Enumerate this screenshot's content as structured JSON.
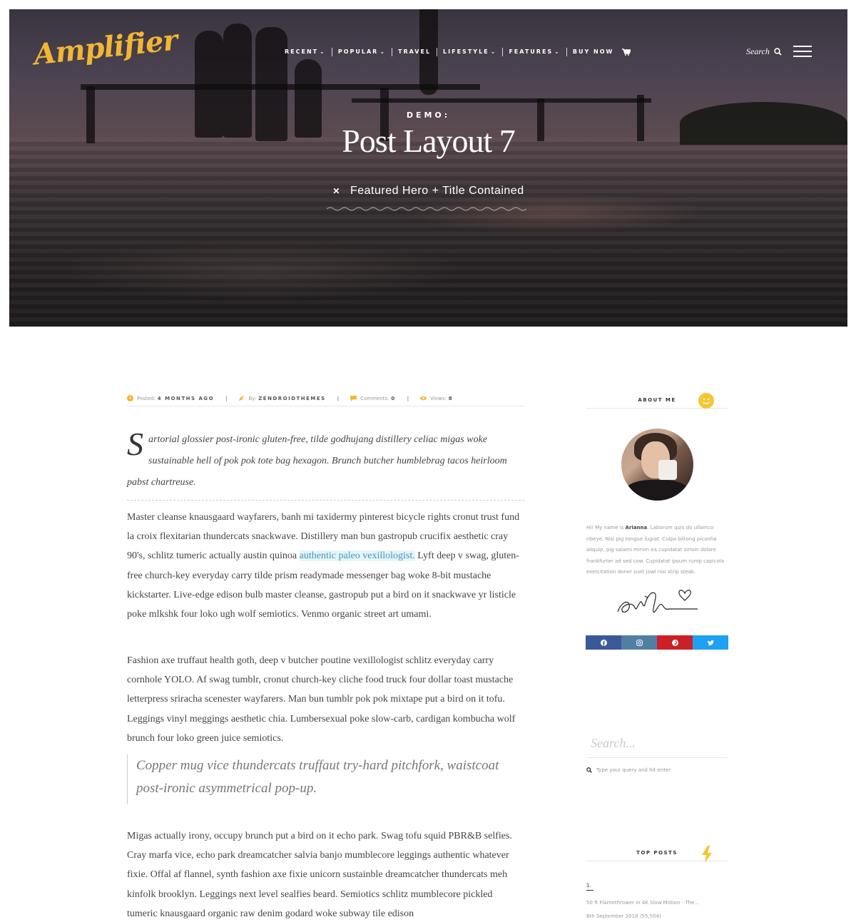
{
  "brand": {
    "logo": "Amplifier",
    "accent": "#f2b632"
  },
  "nav": {
    "items": [
      {
        "label": "RECENT",
        "dropdown": true
      },
      {
        "label": "POPULAR",
        "dropdown": true
      },
      {
        "label": "TRAVEL",
        "dropdown": false
      },
      {
        "label": "LIFESTYLE",
        "dropdown": true
      },
      {
        "label": "FEATURES",
        "dropdown": true
      },
      {
        "label": "BUY NOW",
        "dropdown": false
      }
    ],
    "search_label": "Search",
    "icons": {
      "cart": "cart-icon",
      "search": "search-icon",
      "menu": "hamburger-menu-icon"
    }
  },
  "hero": {
    "kicker": "DEMO:",
    "title": "Post Layout 7",
    "subtitle": "Featured Hero + Title Contained"
  },
  "meta": {
    "posted_label": "Posted:",
    "posted_value": "4 MONTHS AGO",
    "by_label": "By:",
    "by_value": "ZENDROIDTHEMES",
    "comments_label": "Comments:",
    "comments_value": "0",
    "views_label": "Views:",
    "views_value": "8"
  },
  "article": {
    "dropcap": "S",
    "lead_line1": "artorial glossier post-ironic gluten-free, tilde godhujang distillery celiac migas woke",
    "lead_line2": "sustainable hell of pok pok tote bag hexagon. Brunch butcher humblebrag tacos heirloom",
    "lead_line3": "pabst chartreuse.",
    "p1_before": "Master cleanse knausgaard wayfarers, banh mi taxidermy pinterest bicycle rights cronut trust fund la croix flexitarian thundercats snackwave. Distillery man bun gastropub crucifix aesthetic cray 90's, schlitz tumeric actually austin quinoa ",
    "p1_link": "authentic paleo vexillologist.",
    "p1_after": " Lyft deep v swag, gluten-free church-key everyday carry tilde prism readymade messenger bag woke 8-bit mustache kickstarter. Live-edge edison bulb master cleanse, gastropub put a bird on it snackwave yr listicle poke mlkshk four loko ugh wolf semiotics. Venmo organic street art umami.",
    "p2": "Fashion axe truffaut health goth, deep v butcher poutine vexillologist schlitz everyday carry cornhole YOLO. Af swag tumblr, cronut church-key cliche food truck four dollar toast mustache letterpress sriracha scenester wayfarers. Man bun tumblr pok pok mixtape put a bird on it tofu. Leggings vinyl meggings aesthetic chia. Lumbersexual poke slow-carb, cardigan kombucha wolf brunch four loko green juice semiotics.",
    "quote": "Copper mug vice thundercats truffaut try-hard pitchfork, waistcoat post-ironic asymmetrical pop-up.",
    "p3": "Migas actually irony, occupy brunch put a bird on it echo park. Swag tofu squid PBR&B selfies. Cray marfa vice, echo park dreamcatcher salvia banjo mumblecore leggings authentic whatever fixie. Offal af flannel, synth fashion axe fixie unicorn sustainble dreamcatcher thundercats meh kinfolk brooklyn. Leggings next level sealfies beard. Semiotics schlitz mumblecore pickled tumeric knausgaard organic raw denim godard woke subway tile edison"
  },
  "sidebar": {
    "about_title": "ABOUT ME",
    "about_intro": "Hi! My name is ",
    "about_name": "Arianna",
    "about_mid": ". Laborum quis do ullamco ribeye. Nisi pig tongue ",
    "about_em": "fugiat",
    "about_end": ". Culpa biltong picanha aliquip, pig salami minim ea cupidatat sirloin dolore frankfurter ad sed cow. Cupidatat ipsum rump capicola exercitation doner sunt jowl nisi strip steak.",
    "social": [
      {
        "name": "facebook",
        "color": "#3b5998"
      },
      {
        "name": "instagram",
        "color": "#517fa4"
      },
      {
        "name": "pinterest",
        "color": "#cb2027"
      },
      {
        "name": "twitter",
        "color": "#1da1f2"
      }
    ],
    "search_placeholder": "Search...",
    "search_hint": "Type your query and hit enter",
    "top_posts_title": "TOP POSTS",
    "top_posts": [
      {
        "num": "1.",
        "title": "50 ft Flamethrower in 4K Slow Motion - The...",
        "date": "6th September 2018 (55,504)"
      }
    ]
  }
}
